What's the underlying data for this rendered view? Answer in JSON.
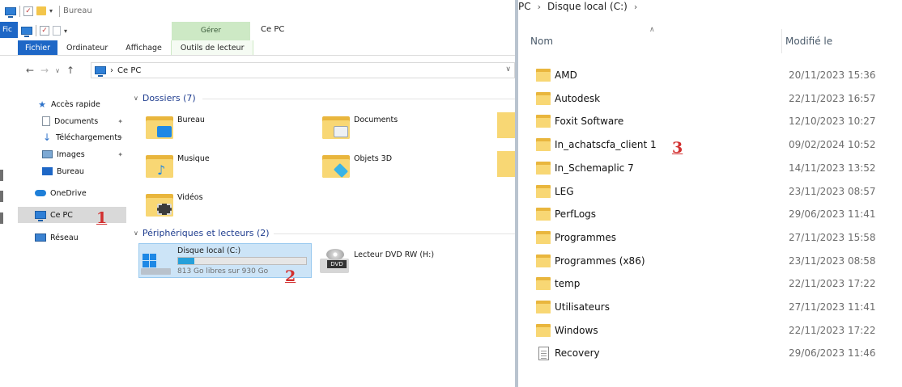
{
  "left_window": {
    "quick_access_title": "Bureau",
    "ribbon": {
      "file_tab_stub": "Fic",
      "context_group": "Gérer",
      "window_title": "Ce PC",
      "tabs": [
        {
          "label": "Fichier",
          "active": true
        },
        {
          "label": "Ordinateur"
        },
        {
          "label": "Affichage"
        },
        {
          "label": "Outils de lecteur"
        }
      ]
    },
    "address": {
      "path": [
        "Ce PC"
      ]
    },
    "nav_pane": {
      "items": [
        {
          "label": "Accès rapide",
          "icon": "star-icon"
        },
        {
          "label": "Documents",
          "icon": "document-icon",
          "pinned": true
        },
        {
          "label": "Téléchargements",
          "icon": "download-icon",
          "pinned": true
        },
        {
          "label": "Images",
          "icon": "images-icon",
          "pinned": true
        },
        {
          "label": "Bureau",
          "icon": "desktop-icon"
        },
        {
          "label": "OneDrive",
          "icon": "cloud-icon"
        },
        {
          "label": "Ce PC",
          "icon": "computer-icon",
          "selected": true
        },
        {
          "label": "Réseau",
          "icon": "network-icon"
        }
      ]
    },
    "folders_group": {
      "header": "Dossiers (7)",
      "items": [
        {
          "label": "Bureau",
          "badge_color": "#1e88e5"
        },
        {
          "label": "Documents",
          "badge_color": "#eef1f4"
        },
        {
          "label": "Musique",
          "badge_color": "#1e88e5"
        },
        {
          "label": "Objets 3D",
          "badge_color": "#39b3e6"
        },
        {
          "label": "Vidéos",
          "badge_color": "#3b3b3b"
        }
      ]
    },
    "devices_group": {
      "header": "Périphériques et lecteurs (2)",
      "local_disk": {
        "name": "Disque local (C:)",
        "free_text": "813 Go libres sur 930 Go",
        "used_fraction": 0.126
      },
      "dvd": {
        "name": "Lecteur DVD RW (H:)",
        "label": "DVD"
      }
    },
    "annotations": [
      "1",
      "2"
    ]
  },
  "right_window": {
    "breadcrumb": [
      "PC",
      "Disque local (C:)"
    ],
    "columns": {
      "name": "Nom",
      "modified": "Modifié le"
    },
    "annotation": "3",
    "rows": [
      {
        "name": "AMD",
        "date": "20/11/2023 15:36",
        "type": "folder"
      },
      {
        "name": "Autodesk",
        "date": "22/11/2023 16:57",
        "type": "folder"
      },
      {
        "name": "Foxit Software",
        "date": "12/10/2023 10:27",
        "type": "folder"
      },
      {
        "name": "In_achatscfa_client 1",
        "date": "09/02/2024 10:52",
        "type": "folder"
      },
      {
        "name": "In_Schemaplic 7",
        "date": "14/11/2023 13:52",
        "type": "folder"
      },
      {
        "name": "LEG",
        "date": "23/11/2023 08:57",
        "type": "folder"
      },
      {
        "name": "PerfLogs",
        "date": "29/06/2023 11:41",
        "type": "folder"
      },
      {
        "name": "Programmes",
        "date": "27/11/2023 15:58",
        "type": "folder"
      },
      {
        "name": "Programmes (x86)",
        "date": "23/11/2023 08:58",
        "type": "folder"
      },
      {
        "name": "temp",
        "date": "22/11/2023 17:22",
        "type": "folder"
      },
      {
        "name": "Utilisateurs",
        "date": "27/11/2023 11:41",
        "type": "folder"
      },
      {
        "name": "Windows",
        "date": "22/11/2023 17:22",
        "type": "folder"
      },
      {
        "name": "Recovery",
        "date": "29/06/2023 11:46",
        "type": "file"
      }
    ]
  },
  "colors": {
    "accent": "#1e67c6",
    "context_tab": "#cde9c5",
    "selection": "#cce4f7",
    "annotation": "#d23030"
  }
}
